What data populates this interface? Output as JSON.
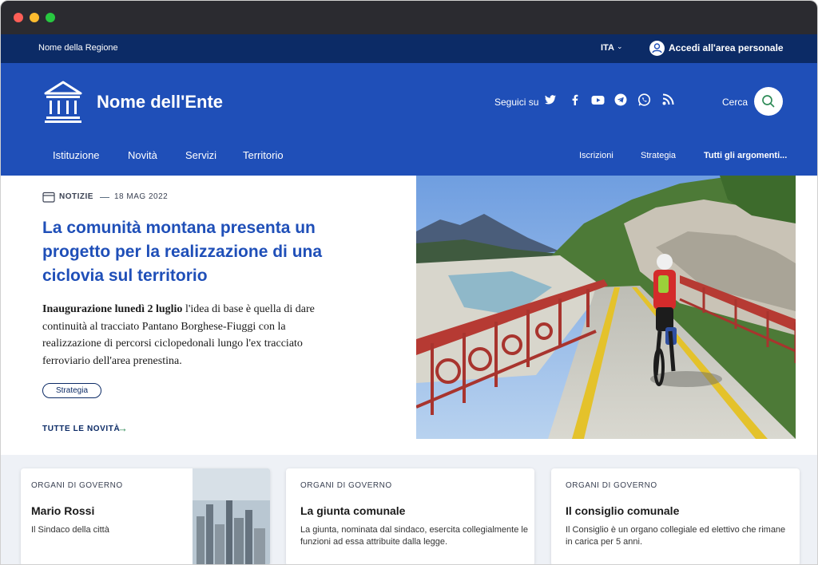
{
  "slim": {
    "region": "Nome della Regione",
    "lang": "ITA",
    "login": "Accedi all'area personale"
  },
  "header": {
    "title": "Nome dell'Ente",
    "follow": "Seguici su",
    "social": [
      "twitter-icon",
      "facebook-icon",
      "youtube-icon",
      "telegram-icon",
      "whatsapp-icon",
      "rss-icon"
    ],
    "search_label": "Cerca"
  },
  "nav": {
    "main": [
      "Istituzione",
      "Novità",
      "Servizi",
      "Territorio"
    ],
    "secondary": [
      "Iscrizioni",
      "Strategia",
      "Tutti gli argomenti..."
    ]
  },
  "hero": {
    "category": "NOTIZIE",
    "date": "18 MAG 2022",
    "headline": "La comunità montana presenta un progetto per la realizzazione di una ciclovia sul territorio",
    "lead_bold": "Inaugurazione lunedì 2 luglio",
    "lead_text": " l'idea di base è quella di dare continuità al tracciato Pantano Borghese-Fiuggi con la realizzazione di percorsi ciclopedonali lungo l'ex tracciato ferroviario dell'area prenestina.",
    "tag": "Strategia",
    "all_news": "TUTTE LE NOVITÀ"
  },
  "cards": [
    {
      "category": "ORGANI DI GOVERNO",
      "title": "Mario Rossi",
      "text": "Il Sindaco della città"
    },
    {
      "category": "ORGANI DI GOVERNO",
      "title": "La giunta comunale",
      "text": "La giunta, nominata dal sindaco, esercita collegialmente le funzioni ad essa attribuite dalla legge."
    },
    {
      "category": "ORGANI DI GOVERNO",
      "title": "Il consiglio comunale",
      "text": "Il Consiglio è un organo collegiale ed elettivo che rimane in carica per 5 anni."
    }
  ],
  "colors": {
    "slim": "#0c2b66",
    "header": "#1f4fb8",
    "headline": "#1f4fb8",
    "accent_green": "#2e8b57"
  }
}
